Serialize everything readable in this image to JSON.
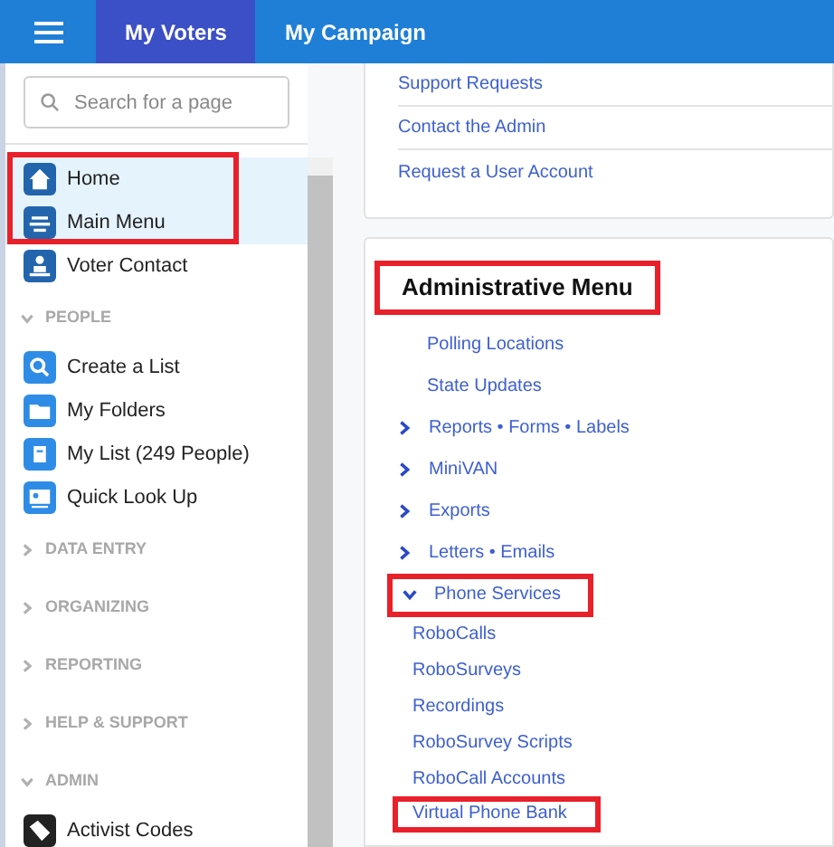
{
  "header": {
    "tabs": [
      {
        "label": "My Voters",
        "selected": true
      },
      {
        "label": "My Campaign",
        "selected": false
      }
    ]
  },
  "sidebar": {
    "search": {
      "placeholder": "Search for a page"
    },
    "items": [
      {
        "label": "Home",
        "kind": "home",
        "highlighted": true,
        "selected": true
      },
      {
        "label": "Main Menu",
        "kind": "menu",
        "highlighted": true,
        "selected": true
      },
      {
        "label": "Voter Contact",
        "kind": "contact",
        "highlighted": false,
        "selected": false
      }
    ],
    "sections": [
      {
        "title": "PEOPLE",
        "expanded": true,
        "items": [
          {
            "label": "Create a List",
            "kind": "search"
          },
          {
            "label": "My Folders",
            "kind": "folder"
          },
          {
            "label": "My List (249 People)",
            "kind": "list"
          },
          {
            "label": "Quick Look Up",
            "kind": "card"
          }
        ]
      },
      {
        "title": "DATA ENTRY",
        "expanded": false
      },
      {
        "title": "ORGANIZING",
        "expanded": false
      },
      {
        "title": "REPORTING",
        "expanded": false
      },
      {
        "title": "HELP & SUPPORT",
        "expanded": false
      },
      {
        "title": "ADMIN",
        "expanded": true,
        "items": [
          {
            "label": "Activist Codes",
            "kind": "tag"
          }
        ]
      }
    ]
  },
  "support_links": [
    "Support Requests",
    "Contact the Admin",
    "Request a User Account"
  ],
  "admin_menu": {
    "title": "Administrative Menu",
    "title_highlighted": true,
    "items": [
      {
        "label": "Polling Locations",
        "kind": "link"
      },
      {
        "label": "State Updates",
        "kind": "link"
      },
      {
        "label": "Reports • Forms • Labels",
        "kind": "group",
        "expanded": false,
        "highlighted": false
      },
      {
        "label": "MiniVAN",
        "kind": "group",
        "expanded": false,
        "highlighted": false
      },
      {
        "label": "Exports",
        "kind": "group",
        "expanded": false,
        "highlighted": false
      },
      {
        "label": "Letters • Emails",
        "kind": "group",
        "expanded": false,
        "highlighted": false
      },
      {
        "label": "Phone Services",
        "kind": "group",
        "expanded": true,
        "highlighted": true,
        "children": [
          {
            "label": "RoboCalls",
            "highlighted": false
          },
          {
            "label": "RoboSurveys",
            "highlighted": false
          },
          {
            "label": "Recordings",
            "highlighted": false
          },
          {
            "label": "RoboSurvey Scripts",
            "highlighted": false
          },
          {
            "label": "RoboCall Accounts",
            "highlighted": false
          },
          {
            "label": "Virtual Phone Bank",
            "highlighted": true
          }
        ]
      }
    ]
  }
}
